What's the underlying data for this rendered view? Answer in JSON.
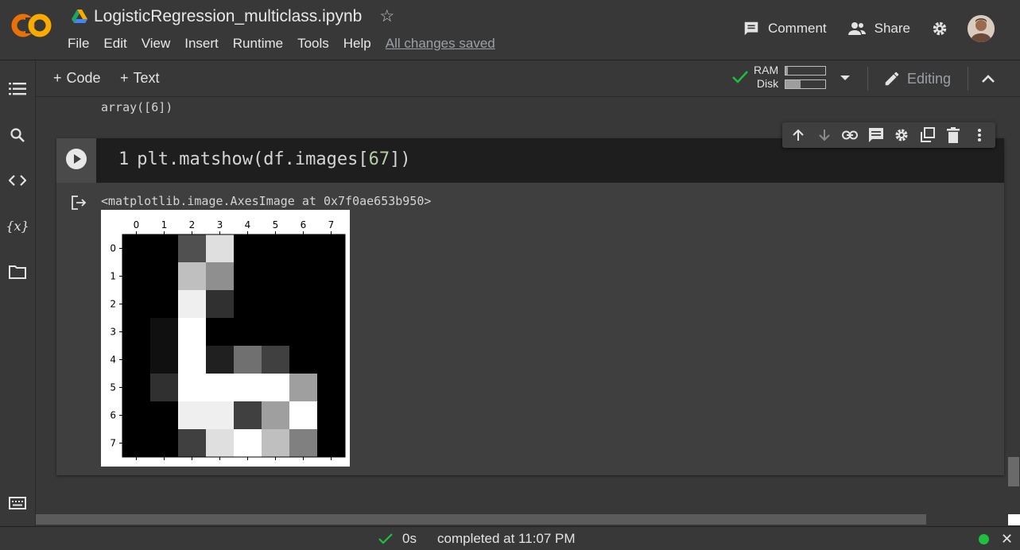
{
  "header": {
    "logo_text": "CO",
    "notebook_title": "LogisticRegression_multiclass.ipynb",
    "menu": [
      "File",
      "Edit",
      "View",
      "Insert",
      "Runtime",
      "Tools",
      "Help"
    ],
    "save_status": "All changes saved",
    "comment_label": "Comment",
    "share_label": "Share",
    "colors": {
      "logo_orange": "#F9AB00",
      "logo_dark_orange": "#E8710A"
    }
  },
  "toolbar": {
    "add_code_label": "Code",
    "add_text_label": "Text",
    "ram_label": "RAM",
    "disk_label": "Disk",
    "ram_usage_fraction": 0.06,
    "disk_usage_fraction": 0.38,
    "editing_label": "Editing"
  },
  "rail": {
    "icons": [
      "table-of-contents-icon",
      "search-icon",
      "code-snippets-icon",
      "variables-icon",
      "files-icon",
      "terminal-icon"
    ],
    "variables_label": "{x}"
  },
  "notebook": {
    "previous_output": "array([6])",
    "cell": {
      "line_number": "1",
      "code_prefix": "plt.matshow(df.images[",
      "code_index": "67",
      "code_suffix": "])",
      "output_text": "<matplotlib.image.AxesImage at 0x7f0ae653b950>"
    }
  },
  "chart_data": {
    "type": "heatmap",
    "colormap": "gray",
    "x_ticks": [
      "0",
      "1",
      "2",
      "3",
      "4",
      "5",
      "6",
      "7"
    ],
    "y_ticks": [
      "0",
      "1",
      "2",
      "3",
      "4",
      "5",
      "6",
      "7"
    ],
    "values": [
      [
        0,
        0,
        5,
        14,
        0,
        0,
        0,
        0
      ],
      [
        0,
        0,
        12,
        9,
        0,
        0,
        0,
        0
      ],
      [
        0,
        0,
        15,
        3,
        0,
        0,
        0,
        0
      ],
      [
        0,
        1,
        16,
        0,
        0,
        0,
        0,
        0
      ],
      [
        0,
        1,
        16,
        2,
        7,
        4,
        0,
        0
      ],
      [
        0,
        3,
        16,
        16,
        16,
        16,
        10,
        0
      ],
      [
        0,
        0,
        15,
        15,
        4,
        10,
        16,
        0
      ],
      [
        0,
        0,
        4,
        14,
        16,
        12,
        8,
        0
      ]
    ],
    "vmin": 0,
    "vmax": 16
  },
  "status": {
    "duration": "0s",
    "completed_text": "completed at 11:07 PM",
    "connected_color": "#1FBF3F"
  }
}
